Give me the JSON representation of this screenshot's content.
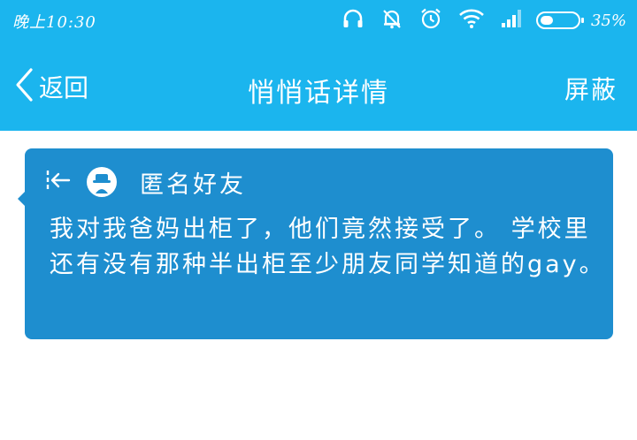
{
  "status_bar": {
    "time": "晚上10:30",
    "battery_percent": "35%",
    "battery_level": 0.35,
    "icons": [
      "headset-icon",
      "bell-off-icon",
      "alarm-icon",
      "wifi-icon",
      "signal-icon",
      "battery-icon"
    ]
  },
  "nav": {
    "back_label": "返回",
    "title": "悄悄话详情",
    "block_label": "屏蔽"
  },
  "message_card": {
    "sender": "匿名好友",
    "text": "我对我爸妈出柜了，他们竟然接受了。 学校里还有没有那种半出柜至少朋友同学知道的gay。",
    "background_color": "#1e8ecf"
  },
  "colors": {
    "header": "#1bb5ee",
    "text_light": "#ffffff"
  }
}
